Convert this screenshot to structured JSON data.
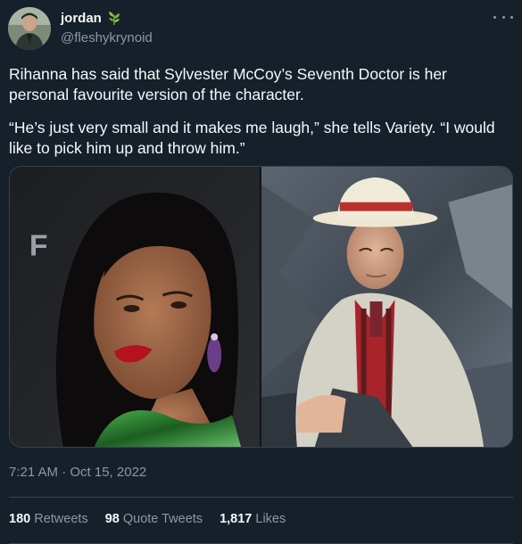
{
  "author": {
    "display_name": "jordan",
    "handle": "@fleshykrynoid",
    "name_emoji": "herb-icon",
    "avatar": "profile-photo"
  },
  "tweet": {
    "paragraphs": [
      "Rihanna has said that Sylvester McCoy’s Seventh Doctor is her personal favourite version of the character.",
      "“He’s just very small and it makes me laugh,” she tells Variety. “I would like to pick him up and throw him.”"
    ],
    "media": [
      {
        "description": "photo-rihanna"
      },
      {
        "description": "photo-seventh-doctor"
      }
    ],
    "timestamp": "7:21 AM · Oct 15, 2022"
  },
  "stats": {
    "retweets": {
      "count": "180",
      "label": "Retweets"
    },
    "quote_tweets": {
      "count": "98",
      "label": "Quote Tweets"
    },
    "likes": {
      "count": "1,817",
      "label": "Likes"
    }
  },
  "colors": {
    "background": "#15202b",
    "text_primary": "#f7f9f9",
    "text_secondary": "#8b98a5",
    "border": "#38444d"
  }
}
